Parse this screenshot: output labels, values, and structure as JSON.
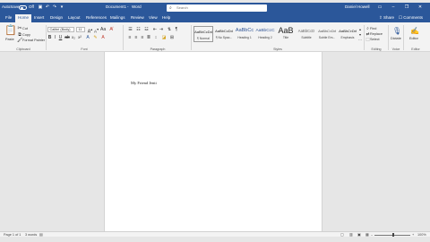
{
  "titlebar": {
    "autosave_label": "AutoSave",
    "autosave_state": "Off",
    "document_title": "Document1",
    "app_name": "Word",
    "search_placeholder": "Search",
    "user_name": "Daniel Howell",
    "user_initials": "DH"
  },
  "tabs": [
    "File",
    "Home",
    "Insert",
    "Design",
    "Layout",
    "References",
    "Mailings",
    "Review",
    "View",
    "Help"
  ],
  "active_tab": "Home",
  "tab_right": {
    "share": "Share",
    "comments": "Comments"
  },
  "ribbon": {
    "clipboard": {
      "paste": "Paste",
      "cut": "Cut",
      "copy": "Copy",
      "format_painter": "Format Painter",
      "label": "Clipboard"
    },
    "font": {
      "font_name": "Calibri (Body)",
      "font_size": "11",
      "label": "Font"
    },
    "paragraph": {
      "label": "Paragraph"
    },
    "styles": {
      "items": [
        {
          "sample": "AaBbCcDd",
          "name": "¶ Normal"
        },
        {
          "sample": "AaBbCcDd",
          "name": "¶ No Spac..."
        },
        {
          "sample": "AaBbCc",
          "name": "Heading 1"
        },
        {
          "sample": "AaBbCcC",
          "name": "Heading 2"
        },
        {
          "sample": "AaB",
          "name": "Title"
        },
        {
          "sample": "AaBbCcD",
          "name": "Subtitle"
        },
        {
          "sample": "AaBbCcDd",
          "name": "Subtle Em..."
        },
        {
          "sample": "AaBbCcDd",
          "name": "Emphasis"
        }
      ],
      "label": "Styles"
    },
    "editing": {
      "find": "Find",
      "replace": "Replace",
      "select": "Select",
      "label": "Editing"
    },
    "voice": {
      "dictate": "Dictate",
      "label": "Voice"
    },
    "editor": {
      "editor": "Editor",
      "label": "Editor"
    }
  },
  "document": {
    "text": "My Friend Jenti"
  },
  "statusbar": {
    "page": "Page 1 of 1",
    "words": "3 words",
    "zoom": "100%"
  }
}
